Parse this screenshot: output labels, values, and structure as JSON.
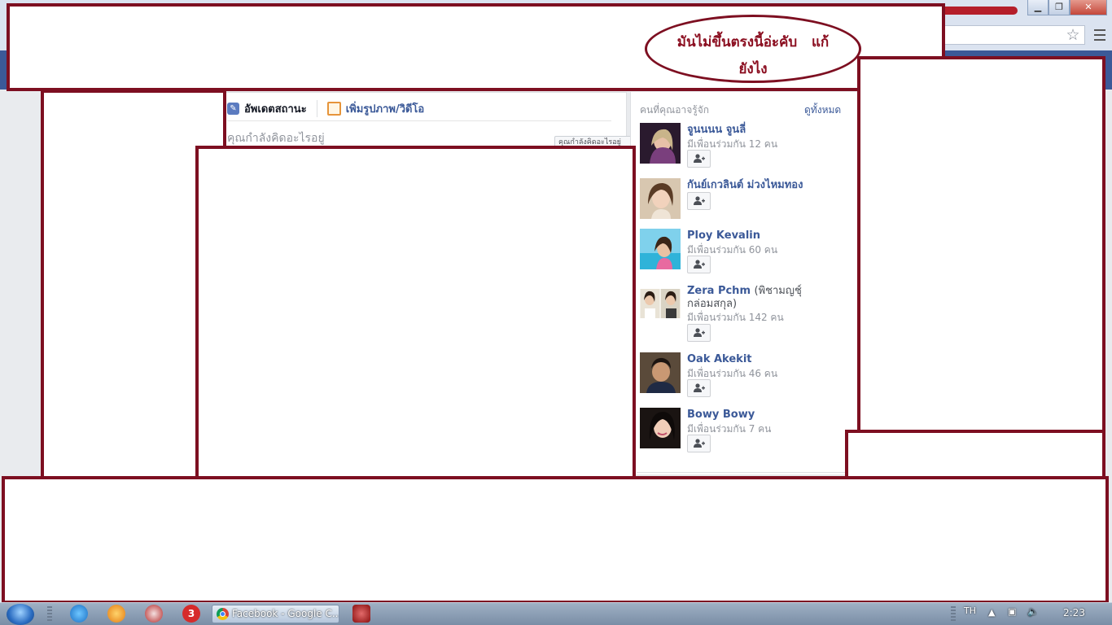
{
  "window": {
    "minimize_glyph": "▁",
    "maximize_glyph": "❐",
    "close_glyph": "✕",
    "star_icon": "☆"
  },
  "composer": {
    "tab_status": "อัพเดตสถานะ",
    "tab_photo": "เพิ่มรูปภาพ/วิดีโอ",
    "placeholder": "คุณกำลังคิดอะไรอยู่",
    "partial_button": "คุณกำลังคิดอะไรอยู่"
  },
  "pymk": {
    "title": "คนที่คุณอาจรู้จัก",
    "see_all": "ดูทั้งหมด",
    "people": [
      {
        "name": "จูนนนน จูนลี่",
        "alt": "",
        "mutual": "มีเพื่อนร่วมกัน 12 คน"
      },
      {
        "name": "กันย์เกวลินต์ ม่วงไหมทอง",
        "alt": "",
        "mutual": ""
      },
      {
        "name": "Ploy Kevalin",
        "alt": "",
        "mutual": "มีเพื่อนร่วมกัน 60 คน"
      },
      {
        "name": "Zera Pchm",
        "alt": "(พิชามญชุ์",
        "alt2": "กล่อมสกุล)",
        "mutual": "มีเพื่อนร่วมกัน 142 คน"
      },
      {
        "name": "Oak Akekit",
        "alt": "",
        "mutual": "มีเพื่อนร่วมกัน 46 คน"
      },
      {
        "name": "Bowy Bowy",
        "alt": "",
        "mutual": "มีเพื่อนร่วมกัน 7 คน"
      }
    ]
  },
  "annotation": {
    "line1": "มันไม่ขึ้นตรงนี้อ่ะคับ   แก้",
    "line2": "ยังไง",
    "color": "#7d0f21"
  },
  "taskbar": {
    "task_label": "Facebook - Google C...",
    "badge": "3",
    "language": "TH",
    "clock": "2:23"
  }
}
